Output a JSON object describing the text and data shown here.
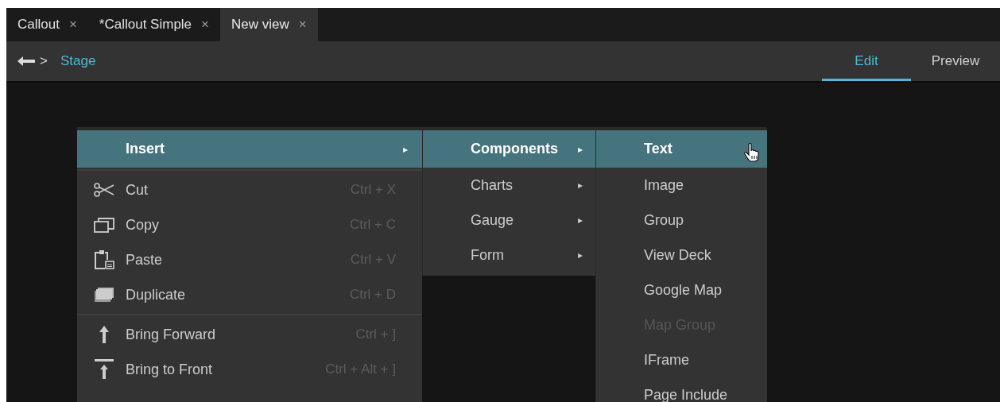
{
  "tabs": [
    {
      "label": "Callout",
      "close": "×",
      "selected": false
    },
    {
      "label": "*Callout Simple",
      "close": "×",
      "selected": false
    },
    {
      "label": "New view",
      "close": "×",
      "selected": true
    }
  ],
  "toolbar": {
    "separator": ">",
    "breadcrumb": "Stage"
  },
  "mode_tabs": [
    {
      "label": "Edit",
      "selected": true
    },
    {
      "label": "Preview",
      "selected": false
    }
  ],
  "context_menu": [
    {
      "kind": "submenu",
      "label": "Insert",
      "arrow": "▸",
      "highlighted": true
    },
    {
      "kind": "separator"
    },
    {
      "kind": "action",
      "label": "Cut",
      "shortcut": "Ctrl + X"
    },
    {
      "kind": "action",
      "label": "Copy",
      "shortcut": "Ctrl + C"
    },
    {
      "kind": "action",
      "label": "Paste",
      "shortcut": "Ctrl + V"
    },
    {
      "kind": "action",
      "label": "Duplicate",
      "shortcut": "Ctrl + D"
    },
    {
      "kind": "separator"
    },
    {
      "kind": "action",
      "label": "Bring Forward",
      "shortcut": "Ctrl + ]"
    },
    {
      "kind": "action",
      "label": "Bring to Front",
      "shortcut": "Ctrl + Alt + ]"
    }
  ],
  "insert_submenu": [
    {
      "label": "Components",
      "arrow": "▸",
      "highlighted": true
    },
    {
      "label": "Charts",
      "arrow": "▸",
      "highlighted": false
    },
    {
      "label": "Gauge",
      "arrow": "▸",
      "highlighted": false
    },
    {
      "label": "Form",
      "arrow": "▸",
      "highlighted": false
    }
  ],
  "components_submenu": [
    {
      "label": "Text",
      "highlighted": true,
      "disabled": false
    },
    {
      "label": "Image",
      "highlighted": false,
      "disabled": false
    },
    {
      "label": "Group",
      "highlighted": false,
      "disabled": false
    },
    {
      "label": "View Deck",
      "highlighted": false,
      "disabled": false
    },
    {
      "label": "Google Map",
      "highlighted": false,
      "disabled": false
    },
    {
      "label": "Map Group",
      "highlighted": false,
      "disabled": true
    },
    {
      "label": "IFrame",
      "highlighted": false,
      "disabled": false
    },
    {
      "label": "Page Include",
      "highlighted": false,
      "disabled": false
    }
  ]
}
